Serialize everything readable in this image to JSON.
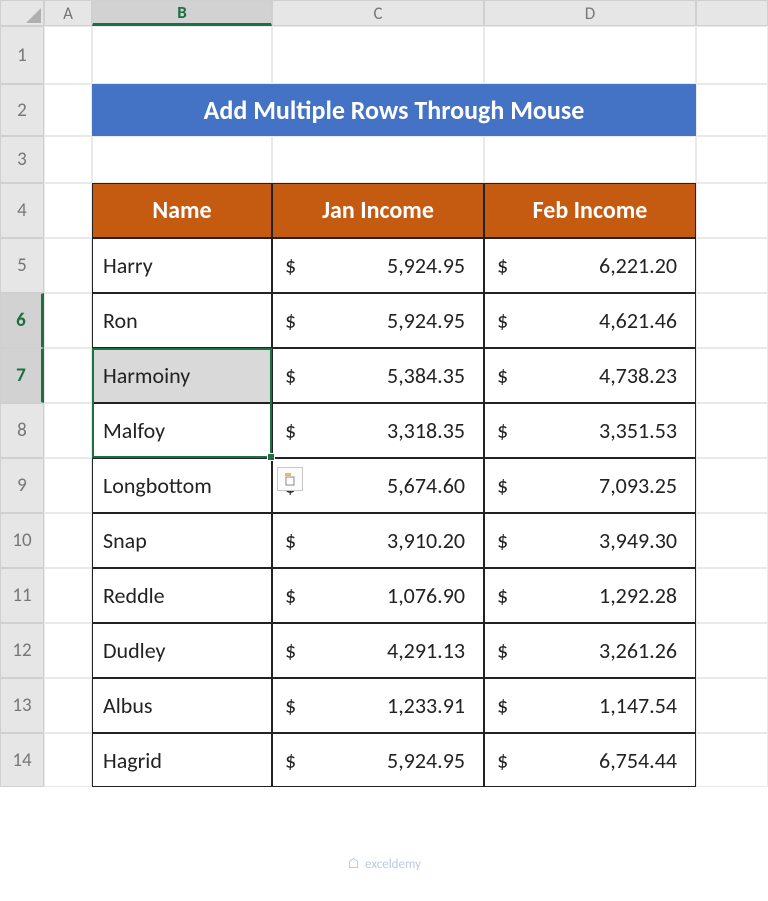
{
  "columns": [
    "A",
    "B",
    "C",
    "D",
    ""
  ],
  "rows": [
    "1",
    "2",
    "3",
    "4",
    "5",
    "6",
    "7",
    "8",
    "9",
    "10",
    "11",
    "12",
    "13",
    "14"
  ],
  "selectedCol": "B",
  "selectedRows": [
    "6",
    "7"
  ],
  "title": "Add Multiple Rows Through Mouse",
  "headers": {
    "name": "Name",
    "jan": "Jan Income",
    "feb": "Feb Income"
  },
  "currency": "$",
  "data": [
    {
      "name": "Harry",
      "jan": "5,924.95",
      "feb": "6,221.20"
    },
    {
      "name": "Ron",
      "jan": "5,924.95",
      "feb": "4,621.46"
    },
    {
      "name": "Harmoiny",
      "jan": "5,384.35",
      "feb": "4,738.23"
    },
    {
      "name": "Malfoy",
      "jan": "3,318.35",
      "feb": "3,351.53"
    },
    {
      "name": "Longbottom",
      "jan": "5,674.60",
      "feb": "7,093.25"
    },
    {
      "name": "Snap",
      "jan": "3,910.20",
      "feb": "3,949.30"
    },
    {
      "name": "Reddle",
      "jan": "1,076.90",
      "feb": "1,292.28"
    },
    {
      "name": "Dudley",
      "jan": "4,291.13",
      "feb": "3,261.26"
    },
    {
      "name": "Albus",
      "jan": "1,233.91",
      "feb": "1,147.54"
    },
    {
      "name": "Hagrid",
      "jan": "5,924.95",
      "feb": "6,754.44"
    }
  ],
  "watermark": "exceldemy",
  "pasteIcon": "paste-options-icon"
}
